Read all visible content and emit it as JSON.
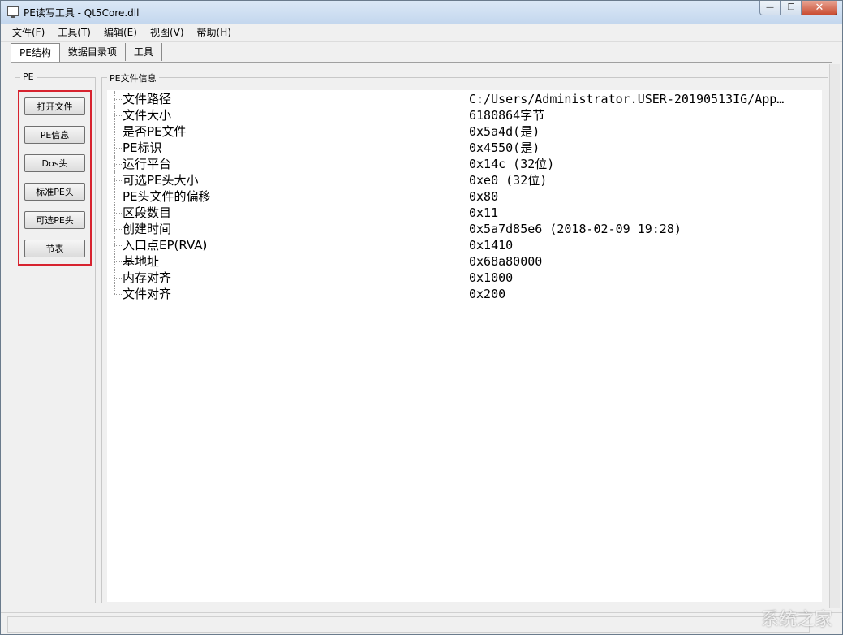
{
  "window": {
    "title": "PE读写工具 - Qt5Core.dll"
  },
  "menubar": [
    {
      "label": "文件(F)"
    },
    {
      "label": "工具(T)"
    },
    {
      "label": "编辑(E)"
    },
    {
      "label": "视图(V)"
    },
    {
      "label": "帮助(H)"
    }
  ],
  "tabs": [
    {
      "label": "PE结构",
      "active": true
    },
    {
      "label": "数据目录项",
      "active": false
    },
    {
      "label": "工具",
      "active": false
    }
  ],
  "left_group": {
    "label": "PE",
    "buttons": [
      {
        "label": "打开文件"
      },
      {
        "label": "PE信息"
      },
      {
        "label": "Dos头"
      },
      {
        "label": "标准PE头"
      },
      {
        "label": "可选PE头"
      },
      {
        "label": "节表"
      }
    ]
  },
  "info_group": {
    "label": "PE文件信息",
    "rows": [
      {
        "key": "文件路径",
        "value": "C:/Users/Administrator.USER-20190513IG/App…"
      },
      {
        "key": "文件大小",
        "value": "6180864字节"
      },
      {
        "key": "是否PE文件",
        "value": "0x5a4d(是)"
      },
      {
        "key": "PE标识",
        "value": "0x4550(是)"
      },
      {
        "key": "运行平台",
        "value": "0x14c (32位)"
      },
      {
        "key": "可选PE头大小",
        "value": "0xe0 (32位)"
      },
      {
        "key": "PE头文件的偏移",
        "value": "0x80"
      },
      {
        "key": "区段数目",
        "value": "0x11"
      },
      {
        "key": "创建时间",
        "value": "0x5a7d85e6 (2018-02-09 19:28)"
      },
      {
        "key": "入口点EP(RVA)",
        "value": "0x1410"
      },
      {
        "key": "基地址",
        "value": "0x68a80000"
      },
      {
        "key": "内存对齐",
        "value": "0x1000"
      },
      {
        "key": "文件对齐",
        "value": "0x200"
      }
    ]
  },
  "watermark": "系统之家"
}
